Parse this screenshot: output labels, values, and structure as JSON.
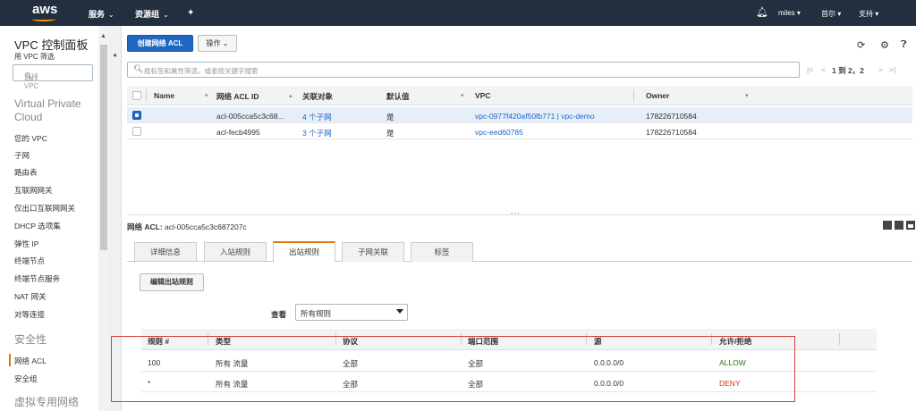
{
  "topnav": {
    "logo": "aws",
    "services": "服务",
    "resource_groups": "资源组",
    "user": "miles",
    "region": "首尔",
    "support": "支持"
  },
  "sidebar": {
    "title": "VPC 控制面板",
    "filter_label": "用 VPC 筛选",
    "select_placeholder": "选择 VPC",
    "section_vpc": "Virtual Private Cloud",
    "items": [
      "您的 VPC",
      "子网",
      "路由表",
      "互联网网关",
      "仅出口互联网网关",
      "DHCP 选项集",
      "弹性 IP",
      "终端节点",
      "终端节点服务",
      "NAT 网关",
      "对等连接"
    ],
    "section_security": "安全性",
    "security_items": [
      "网络 ACL",
      "安全组"
    ],
    "section_vpn": "虚拟专用网络"
  },
  "toolbar": {
    "create_label": "创建网络 ACL",
    "actions_label": "操作"
  },
  "search": {
    "placeholder": "按标签和属性筛选，或者按关键字搜索"
  },
  "pager": {
    "text": "1 到 2，2"
  },
  "table": {
    "columns": [
      "Name",
      "网络 ACL ID",
      "关联对象",
      "默认值",
      "VPC",
      "Owner"
    ],
    "rows": [
      {
        "name": "",
        "acl_id": "acl-005cca5c3c68...",
        "assoc": "4 个子网",
        "default": "是",
        "vpc": "vpc-0977f420af50fb771 | vpc-demo",
        "owner": "178226710584",
        "selected": true
      },
      {
        "name": "",
        "acl_id": "acl-fecb4995",
        "assoc": "3 个子网",
        "default": "是",
        "vpc": "vpc-eed60785",
        "owner": "178226710584",
        "selected": false
      }
    ]
  },
  "detail": {
    "label": "网络 ACL:",
    "acl_id": "acl-005cca5c3c687207c",
    "tabs": [
      "详细信息",
      "入站规则",
      "出站规则",
      "子网关联",
      "标签"
    ],
    "active_tab": "出站规则",
    "edit_button": "编辑出站规则",
    "view_label": "查看",
    "view_value": "所有规则",
    "rule_columns": [
      "规则 #",
      "类型",
      "协议",
      "端口范围",
      "源",
      "允许/拒绝"
    ],
    "rules": [
      {
        "num": "100",
        "type": "所有 流量",
        "protocol": "全部",
        "ports": "全部",
        "source": "0.0.0.0/0",
        "action": "ALLOW"
      },
      {
        "num": "*",
        "type": "所有 流量",
        "protocol": "全部",
        "ports": "全部",
        "source": "0.0.0.0/0",
        "action": "DENY"
      }
    ]
  },
  "colors": {
    "nav_bg": "#232f3e",
    "primary": "#1f67c2",
    "accent": "#e47911",
    "allow": "#1d8102",
    "deny": "#d13212",
    "highlight": "#d63f3f"
  }
}
